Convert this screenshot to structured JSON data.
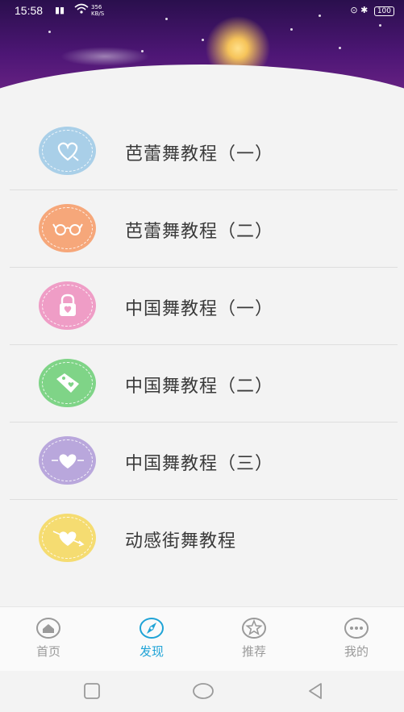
{
  "status_bar": {
    "time": "15:58",
    "signal": "☼",
    "net_top": "356",
    "net_bottom": "KB/S",
    "battery": "100"
  },
  "list": {
    "items": [
      {
        "label": "芭蕾舞教程（一）",
        "icon": "heart-outline-icon",
        "color": "#a9cfe8"
      },
      {
        "label": "芭蕾舞教程（二）",
        "icon": "glasses-icon",
        "color": "#f6a77a"
      },
      {
        "label": "中国舞教程（一）",
        "icon": "lock-icon",
        "color": "#ef9dc6"
      },
      {
        "label": "中国舞教程（二）",
        "icon": "tag-icon",
        "color": "#7fd487"
      },
      {
        "label": "中国舞教程（三）",
        "icon": "heart-icon",
        "color": "#b9a7dc"
      },
      {
        "label": "动感街舞教程",
        "icon": "heart-arrow-icon",
        "color": "#f5dc71"
      }
    ]
  },
  "tabbar": {
    "tabs": [
      {
        "label": "首页",
        "icon": "home-icon",
        "active": false
      },
      {
        "label": "发现",
        "icon": "compass-icon",
        "active": true
      },
      {
        "label": "推荐",
        "icon": "star-icon",
        "active": false
      },
      {
        "label": "我的",
        "icon": "more-icon",
        "active": false
      }
    ]
  },
  "colors": {
    "accent": "#1fa3d6",
    "inactive": "#9a9a9a"
  }
}
